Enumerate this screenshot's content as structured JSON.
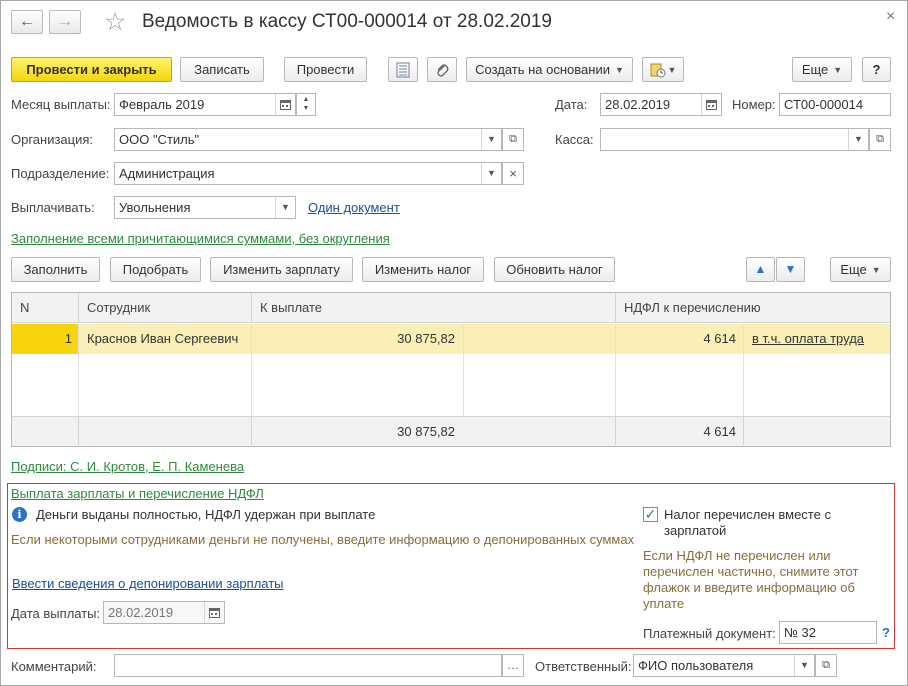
{
  "window": {
    "title": "Ведомость в кассу СТ00-000014 от 28.02.2019",
    "back_icon": "←",
    "forward_icon": "→",
    "star_icon": "☆",
    "close_icon": "×"
  },
  "toolbar": {
    "post_close": "Провести и закрыть",
    "save": "Записать",
    "post": "Провести",
    "create_based": "Создать на основании",
    "more": "Еще",
    "help": "?"
  },
  "header": {
    "month_label": "Месяц выплаты:",
    "month_value": "Февраль 2019",
    "date_label": "Дата:",
    "date_value": "28.02.2019",
    "number_label": "Номер:",
    "number_value": "СТ00-000014",
    "org_label": "Организация:",
    "org_value": "ООО \"Стиль\"",
    "cash_label": "Касса:",
    "cash_value": "",
    "dept_label": "Подразделение:",
    "dept_value": "Администрация",
    "pay_label": "Выплачивать:",
    "pay_value": "Увольнения",
    "one_doc_link": "Один документ",
    "fill_mode_link": "Заполнение всеми причитающимися суммами, без округления"
  },
  "table_toolbar": {
    "fill": "Заполнить",
    "pick": "Подобрать",
    "change_salary": "Изменить зарплату",
    "change_tax": "Изменить налог",
    "update_tax": "Обновить налог",
    "up_icon": "▲",
    "down_icon": "▼",
    "more": "Еще"
  },
  "table": {
    "columns": [
      "N",
      "Сотрудник",
      "К выплате",
      "НДФЛ к перечислению"
    ],
    "rows": [
      {
        "n": "1",
        "employee": "Краснов Иван Сергеевич",
        "amount": "30 875,82",
        "tax": "4 614",
        "tax_link": "в т.ч. оплата труда"
      }
    ],
    "totals": {
      "amount": "30 875,82",
      "tax": "4 614"
    }
  },
  "signatures_link": "Подписи: С. И. Кротов, Е. П. Каменева",
  "payment_group": {
    "title_link": "Выплата зарплаты и перечисление НДФЛ",
    "info_icon": "i",
    "info_text": "Деньги выданы полностью, НДФЛ удержан при выплате",
    "hint_text": "Если некоторыми сотрудниками деньги не получены, введите информацию о депонированных суммах",
    "deposit_link": "Ввести сведения о депонировании зарплаты",
    "pay_date_label": "Дата выплаты:",
    "pay_date_value": "28.02.2019",
    "tax_checkbox_checked": true,
    "tax_checkbox_label": "Налог перечислен вместе с зарплатой",
    "tax_hint": "Если НДФЛ не перечислен или перечислен частично, снимите этот флажок и введите информацию об уплате",
    "payment_doc_label": "Платежный документ:",
    "payment_doc_value": "№ 32",
    "help_icon": "?"
  },
  "footer": {
    "comment_label": "Комментарий:",
    "comment_value": "",
    "responsible_label": "Ответственный:",
    "responsible_value": "ФИО пользователя"
  },
  "colors": {
    "primary_button": "#f6d50d",
    "selected_row": "#fbefb8",
    "link_green": "#2e8b3e",
    "link_blue": "#1a4fa0",
    "group_border": "#e03030"
  }
}
